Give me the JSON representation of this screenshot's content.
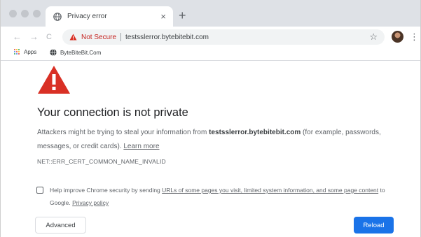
{
  "tab": {
    "title": "Privacy error",
    "close_glyph": "×",
    "favicon": "globe-icon",
    "new_tab_glyph": "+"
  },
  "toolbar": {
    "back_glyph": "←",
    "forward_glyph": "→",
    "reload_glyph": "C",
    "security_label": "Not Secure",
    "url": "testsslerror.bytebitebit.com",
    "star_glyph": "☆",
    "menu_glyph": "⋮"
  },
  "bookmarks": {
    "apps_label": "Apps",
    "site_label": "ByteBiteBit.Com"
  },
  "interstitial": {
    "heading": "Your connection is not private",
    "intro_before": "Attackers might be trying to steal your information from ",
    "domain": "testsslerror.bytebitebit.com",
    "intro_after": " (for example, passwords, messages, or credit cards). ",
    "learn_more": "Learn more",
    "error_code": "NET::ERR_CERT_COMMON_NAME_INVALID",
    "improve_before": "Help improve Chrome security by sending ",
    "improve_link1": "URLs of some pages you visit, limited system information, and some page content",
    "improve_middle": " to Google. ",
    "privacy_policy": "Privacy policy",
    "advanced_button": "Advanced",
    "reload_button": "Reload"
  },
  "colors": {
    "warning_red": "#d93025",
    "not_secure_red": "#c5221f",
    "primary_blue": "#1a73e8",
    "tabstrip_gray": "#dee1e6"
  }
}
